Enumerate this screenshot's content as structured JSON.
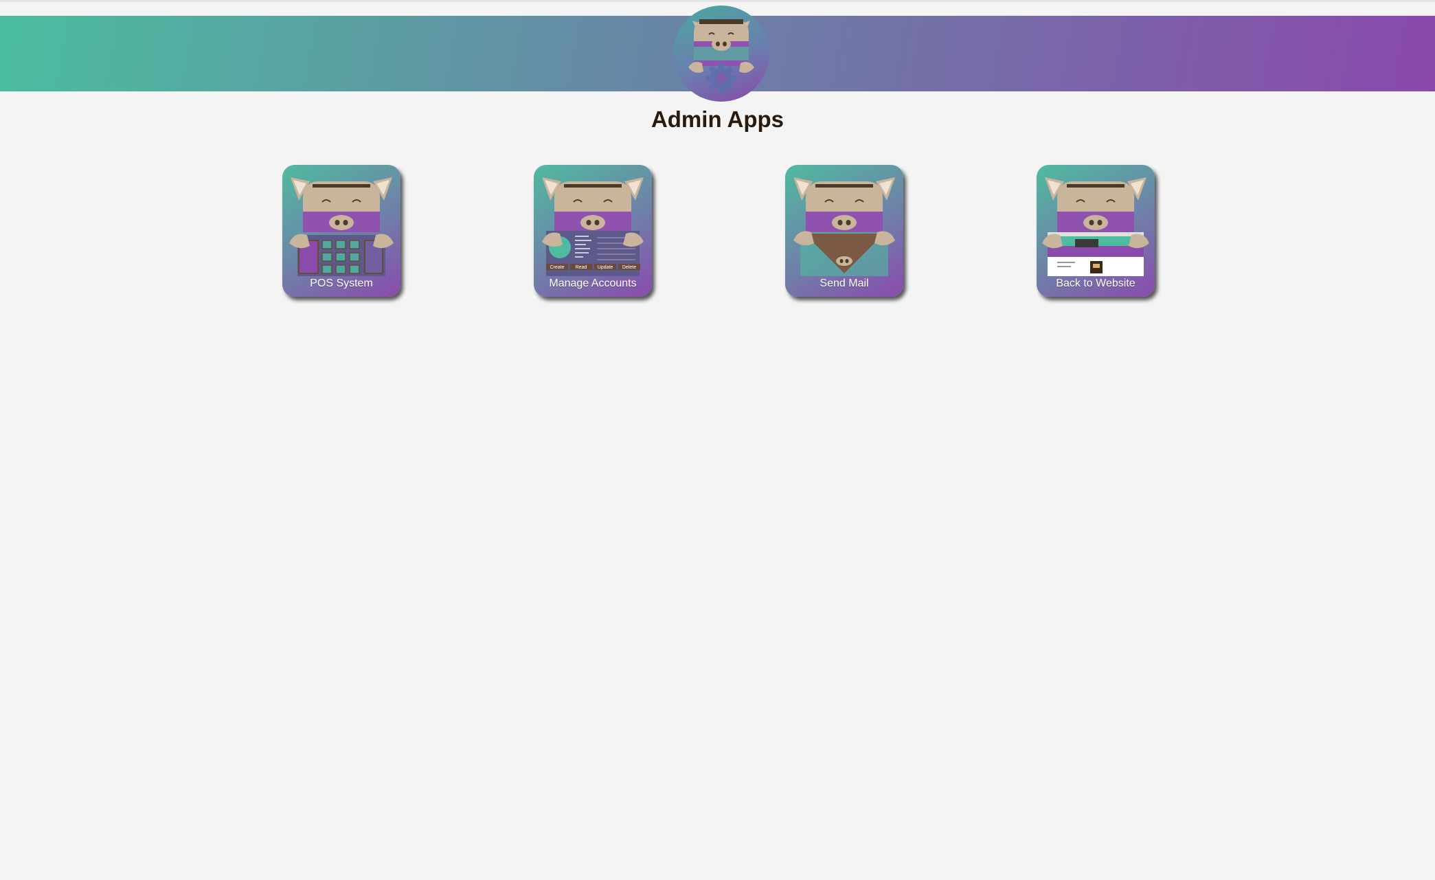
{
  "header": {
    "logo_icon": "pig-gear-logo-icon",
    "gradient": [
      "#4bbd9f",
      "#6a83a6",
      "#8a48ac"
    ]
  },
  "page": {
    "title": "Admin Apps"
  },
  "apps": [
    {
      "label": "POS System",
      "icon": "pig-keypad-icon"
    },
    {
      "label": "Manage Accounts",
      "icon": "pig-accounts-icon"
    },
    {
      "label": "Send Mail",
      "icon": "pig-envelope-icon"
    },
    {
      "label": "Back to Website",
      "icon": "pig-website-icon"
    }
  ],
  "accounts_screen": {
    "buttons": [
      "Create",
      "Read",
      "Update",
      "Delete"
    ]
  }
}
